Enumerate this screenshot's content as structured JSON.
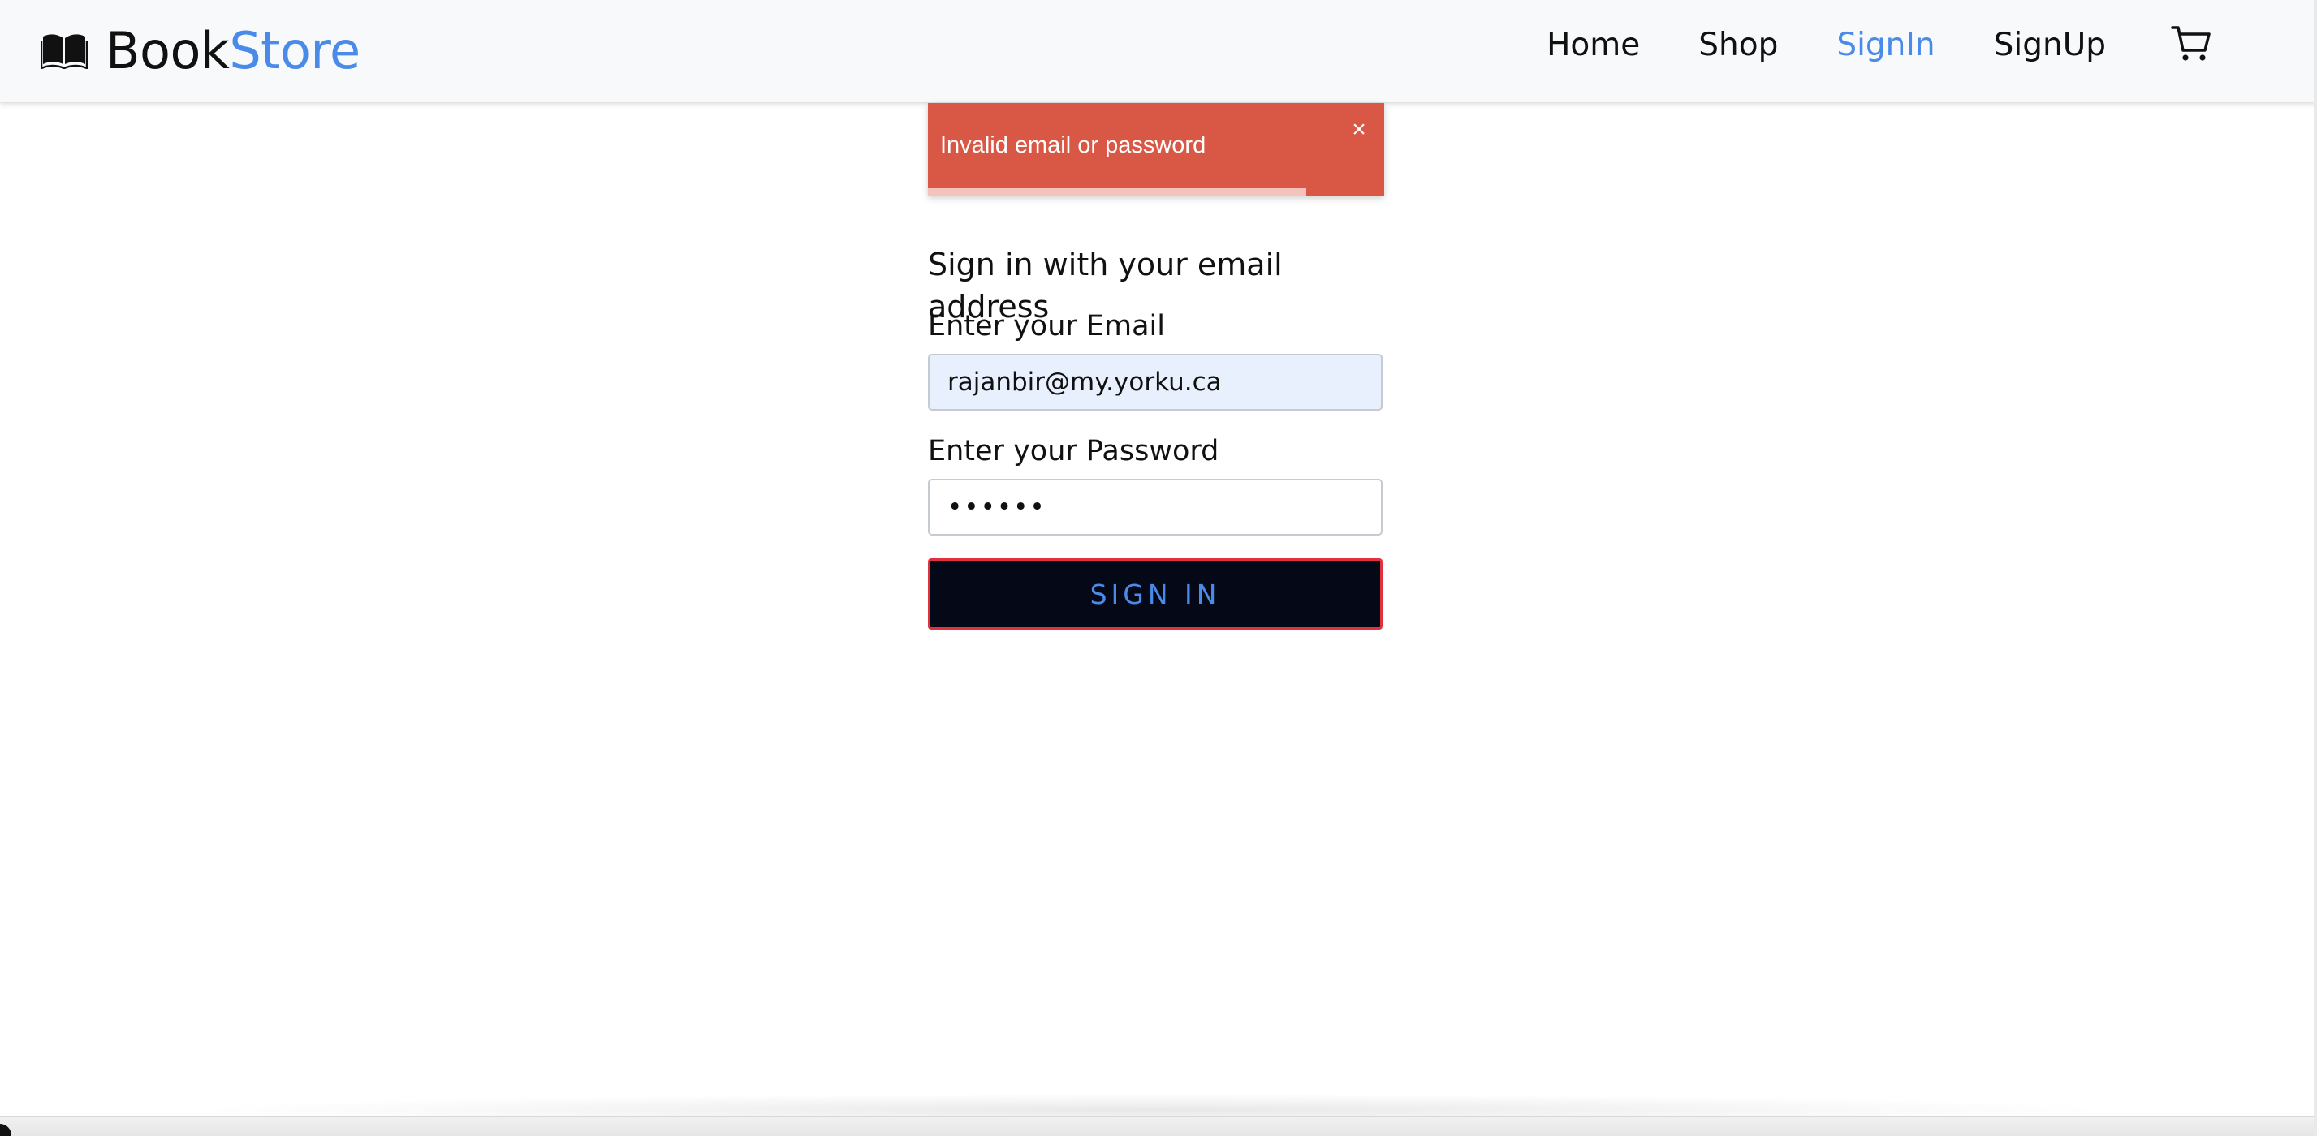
{
  "brand": {
    "name_primary": "Book",
    "name_accent": "Store",
    "icon": "open-book-icon"
  },
  "nav": {
    "items": [
      {
        "label": "Home",
        "active": false
      },
      {
        "label": "Shop",
        "active": false
      },
      {
        "label": "SignIn",
        "active": true
      },
      {
        "label": "SignUp",
        "active": false
      }
    ],
    "cart_icon": "cart-icon"
  },
  "toast": {
    "message": "Invalid email or password",
    "close_icon": "close-icon",
    "close_glyph": "×",
    "progress_fraction": 0.83
  },
  "form": {
    "title": "Sign in with your email address",
    "email_label": "Enter your Email",
    "email_value": "rajanbir@my.yorku.ca",
    "password_label": "Enter your Password",
    "password_value": "••••••",
    "submit_label": "SIGN IN"
  },
  "colors": {
    "accent": "#4a8ae8",
    "toast_bg": "#d95745",
    "button_bg": "#050816",
    "button_border": "#e0313f",
    "email_bg": "#e8f0fe"
  }
}
